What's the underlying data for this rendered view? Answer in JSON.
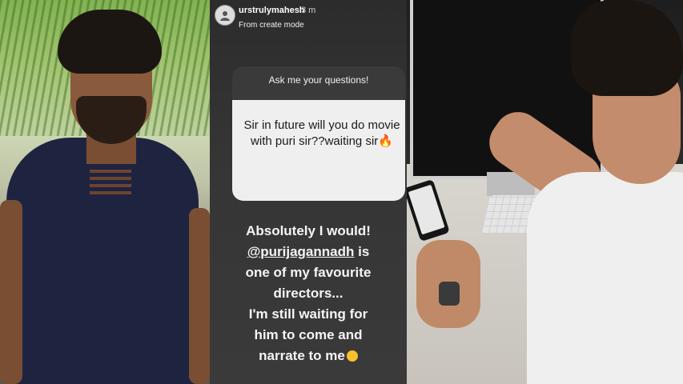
{
  "story": {
    "username": "urstrulymahesh",
    "time": "3 m",
    "mode": "From create mode",
    "question_prompt": "Ask me your questions!",
    "question": "Sir in future will you do movie with puri sir??waiting sir🔥",
    "answer": {
      "line1": "Absolutely I would!",
      "mention": "@purijagannadh",
      "line2_suffix": "is",
      "line3": "one of my favourite",
      "line4": "directors...",
      "line5": "I'm still waiting for",
      "line6": "him to come and",
      "line7": "narrate to me"
    }
  },
  "icons": {
    "avatar": "user-avatar-icon",
    "emoji": "smiling-face-emoji-icon"
  }
}
